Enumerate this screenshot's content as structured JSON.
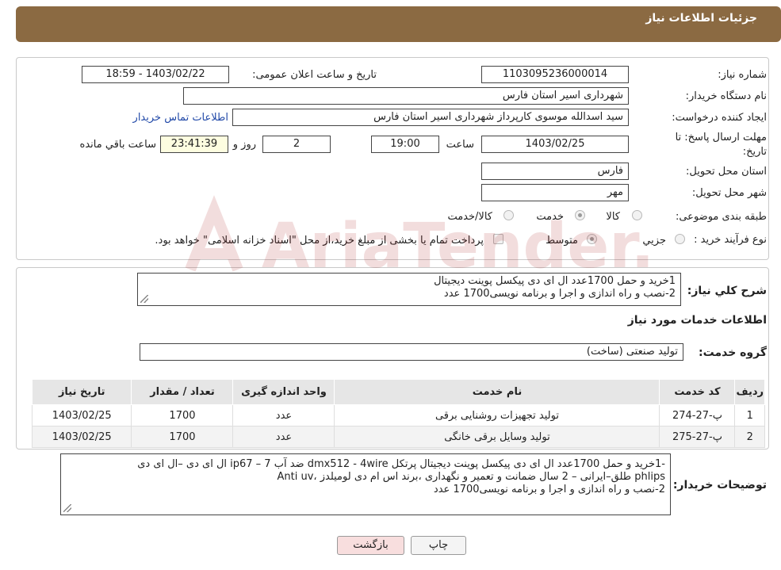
{
  "header": {
    "title": "جزئیات اطلاعات نیاز"
  },
  "form": {
    "need_number_label": "شماره نیاز:",
    "need_number": "1103095236000014",
    "announce_label": "تاریخ و ساعت اعلان عمومی:",
    "announce_value": "1403/02/22 - 18:59",
    "buyer_org_label": "نام دستگاه خریدار:",
    "buyer_org": "شهرداری اسیر استان فارس",
    "requester_label": "ایجاد کننده درخواست:",
    "requester": "سید اسدالله موسوی کارپرداز شهرداری اسیر استان فارس",
    "contact_link": "اطلاعات تماس خریدار",
    "deadline_label_1": "مهلت ارسال پاسخ: تا",
    "deadline_label_2": "تاریخ:",
    "deadline_date": "1403/02/25",
    "time_label": "ساعت",
    "deadline_time": "19:00",
    "days_value": "2",
    "days_label": "روز و",
    "remaining_time": "23:41:39",
    "remaining_label": "ساعت باقي مانده",
    "province_label": "استان محل تحویل:",
    "province": "فارس",
    "city_label": "شهر محل تحویل:",
    "city": "مهر",
    "category_label": "طبقه بندی موضوعی:",
    "category_options": [
      "کالا",
      "خدمت",
      "کالا/خدمت"
    ],
    "process_label": "نوع فرآیند خرید :",
    "process_options": [
      "جزیي",
      "متوسط"
    ],
    "treasury_text": "پرداخت تمام یا بخشی از مبلغ خرید،از محل \"اسناد خزانه اسلامی\" خواهد بود."
  },
  "summary": {
    "label": "شرح کلي نیاز:",
    "lines": [
      "1خرید و حمل 1700عدد ال ای دی پیکسل پوینت دیجیتال",
      "2-نصب و راه اندازی و اجرا و برنامه نویسی1700 عدد"
    ],
    "services_title": "اطلاعات خدمات مورد نیاز",
    "group_label": "گروه خدمت:",
    "group_value": "تولید صنعتی (ساخت)"
  },
  "table": {
    "headers": [
      "ردیف",
      "کد خدمت",
      "نام خدمت",
      "واحد اندازه گیری",
      "تعداد / مقدار",
      "تاریخ نیاز"
    ],
    "rows": [
      [
        "1",
        "پ-27-274",
        "تولید تجهیزات روشنایی برقی",
        "عدد",
        "1700",
        "1403/02/25"
      ],
      [
        "2",
        "پ-27-275",
        "تولید وسایل برقی خانگی",
        "عدد",
        "1700",
        "1403/02/25"
      ]
    ]
  },
  "buyer_notes": {
    "label": "توضیحات خریدار:",
    "lines": [
      "-1خرید و حمل 1700عدد ال ای دی پیکسل پوینت دیجیتال پرتکل dmx512  - 4wire  ضد آب ip67 – 7 ال ای دی –ال ای دی",
      "phlips طلق–ایرانی – 2 سال ضمانت و تعمیر و نگهداری ،برند اس ام دی لومیلدز ،Anti uv",
      "2-نصب و راه اندازی و اجرا و برنامه نویسی1700 عدد"
    ]
  },
  "buttons": {
    "print": "چاپ",
    "back": "بازگشت"
  },
  "watermark": {
    "text": "AriaTender.neT"
  },
  "colors": {
    "header": "#8b6a42",
    "link": "#2149a8",
    "back_button": "#f8dede"
  }
}
